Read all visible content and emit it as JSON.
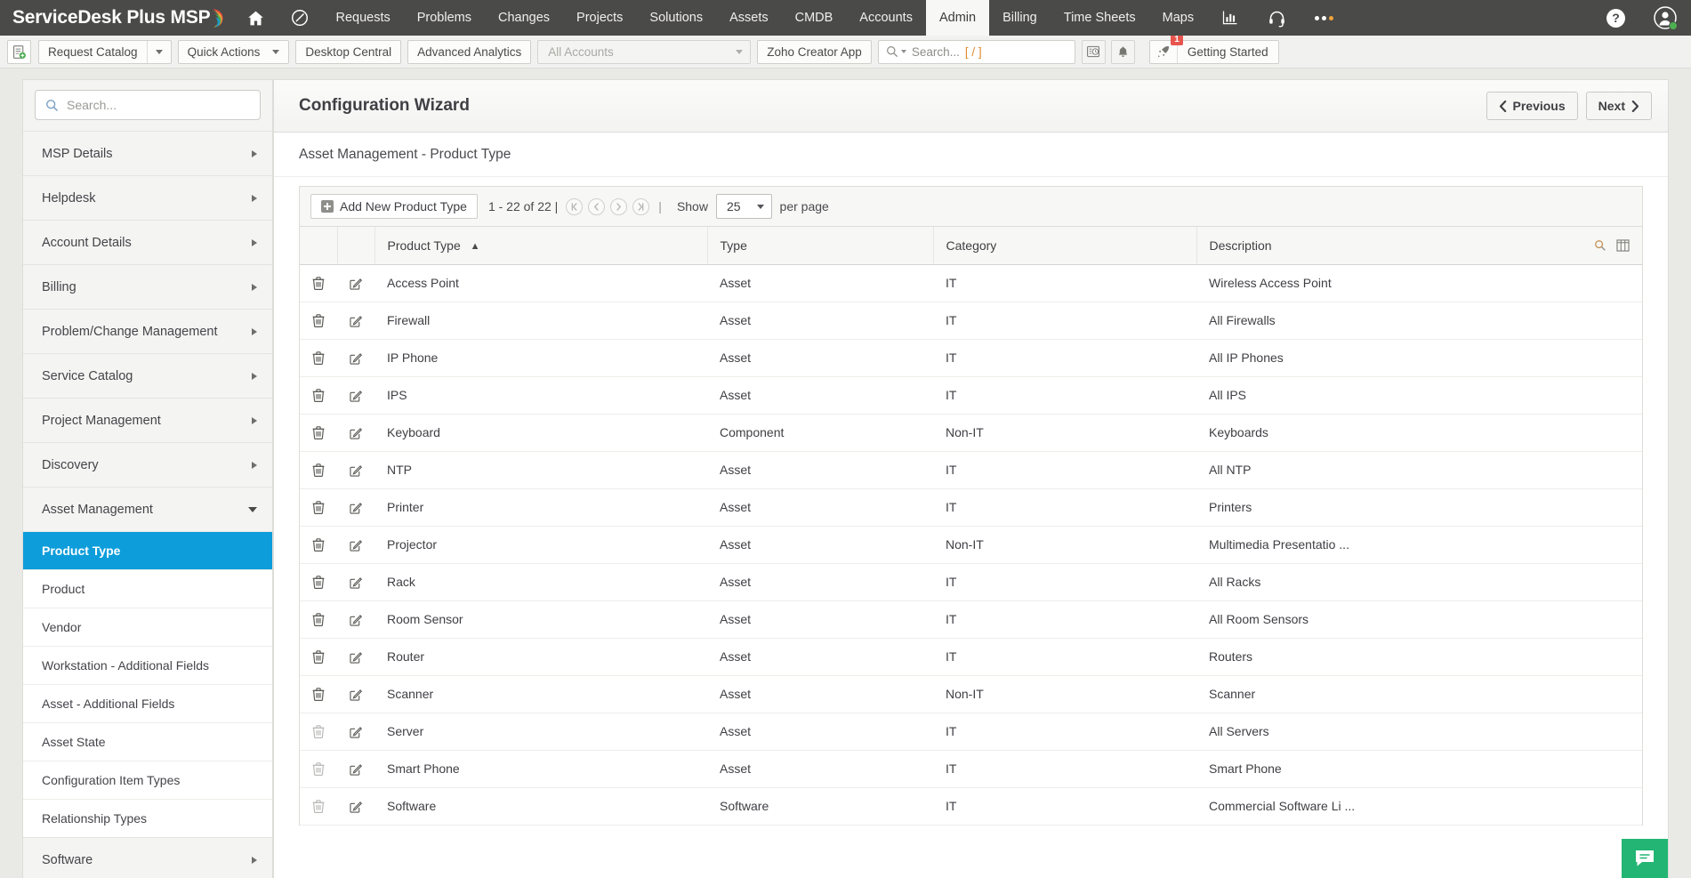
{
  "topnav": {
    "brand": "ServiceDesk Plus MSP",
    "items": [
      {
        "label": "Requests",
        "active": false
      },
      {
        "label": "Problems",
        "active": false
      },
      {
        "label": "Changes",
        "active": false
      },
      {
        "label": "Projects",
        "active": false
      },
      {
        "label": "Solutions",
        "active": false
      },
      {
        "label": "Assets",
        "active": false
      },
      {
        "label": "CMDB",
        "active": false
      },
      {
        "label": "Accounts",
        "active": false
      },
      {
        "label": "Admin",
        "active": true
      },
      {
        "label": "Billing",
        "active": false
      },
      {
        "label": "Time Sheets",
        "active": false
      },
      {
        "label": "Maps",
        "active": false
      }
    ],
    "icons": {
      "home": "home-icon",
      "dashboard": "speedometer-icon",
      "reports": "bar-chart-icon",
      "support": "headset-icon",
      "more": "more-dots-icon",
      "help": "help-icon",
      "profile": "user-avatar-icon"
    },
    "help_glyph": "?"
  },
  "toolbar": {
    "new_request_icon": "new-request-icon",
    "request_catalog": "Request Catalog",
    "quick_actions": "Quick Actions",
    "desktop_central": "Desktop Central",
    "advanced_analytics": "Advanced Analytics",
    "accounts_placeholder": "All Accounts",
    "zoho_creator": "Zoho Creator App",
    "search_placeholder": "Search...",
    "search_shortcut": "[ / ]",
    "recent_items_icon": "recent-items-icon",
    "notifications_icon": "bell-icon",
    "rocket_icon": "rocket-icon",
    "getting_started": "Getting Started",
    "getting_started_badge": "1"
  },
  "sidebar": {
    "search_placeholder": "Search...",
    "items": [
      {
        "label": "MSP Details",
        "expanded": false
      },
      {
        "label": "Helpdesk",
        "expanded": false
      },
      {
        "label": "Account Details",
        "expanded": false
      },
      {
        "label": "Billing",
        "expanded": false
      },
      {
        "label": "Problem/Change Management",
        "expanded": false
      },
      {
        "label": "Service Catalog",
        "expanded": false
      },
      {
        "label": "Project Management",
        "expanded": false
      },
      {
        "label": "Discovery",
        "expanded": false
      },
      {
        "label": "Asset Management",
        "expanded": true
      }
    ],
    "asset_management_children": [
      {
        "label": "Product Type",
        "active": true
      },
      {
        "label": "Product",
        "active": false
      },
      {
        "label": "Vendor",
        "active": false
      },
      {
        "label": "Workstation - Additional Fields",
        "active": false
      },
      {
        "label": "Asset - Additional Fields",
        "active": false
      },
      {
        "label": "Asset State",
        "active": false
      },
      {
        "label": "Configuration Item Types",
        "active": false
      },
      {
        "label": "Relationship Types",
        "active": false
      }
    ],
    "trailing_item": {
      "label": "Software",
      "expanded": false
    }
  },
  "main": {
    "title": "Configuration Wizard",
    "previous_label": "Previous",
    "next_label": "Next",
    "breadcrumb": "Asset Management - Product Type",
    "add_button": "Add New Product Type",
    "page_range": "1 - 22 of 22 |",
    "pipe": "|",
    "show_label": "Show",
    "per_page_value": "25",
    "per_page_label": "per page",
    "pagination_icons": [
      "first-page-icon",
      "previous-page-icon",
      "next-page-icon",
      "last-page-icon"
    ],
    "header_search_icon": "search-icon",
    "header_columns_icon": "column-chooser-icon",
    "columns": [
      "Product Type",
      "Type",
      "Category",
      "Description"
    ],
    "sort_column": "Product Type",
    "sort_direction": "ascending",
    "rows": [
      {
        "name": "Access Point",
        "type": "Asset",
        "category": "IT",
        "description": "Wireless Access Point",
        "deletable": true
      },
      {
        "name": "Firewall",
        "type": "Asset",
        "category": "IT",
        "description": "All Firewalls",
        "deletable": true
      },
      {
        "name": "IP Phone",
        "type": "Asset",
        "category": "IT",
        "description": "All IP Phones",
        "deletable": true
      },
      {
        "name": "IPS",
        "type": "Asset",
        "category": "IT",
        "description": "All IPS",
        "deletable": true
      },
      {
        "name": "Keyboard",
        "type": "Component",
        "category": "Non-IT",
        "description": "Keyboards",
        "deletable": true
      },
      {
        "name": "NTP",
        "type": "Asset",
        "category": "IT",
        "description": "All NTP",
        "deletable": true
      },
      {
        "name": "Printer",
        "type": "Asset",
        "category": "IT",
        "description": "Printers",
        "deletable": true
      },
      {
        "name": "Projector",
        "type": "Asset",
        "category": "Non-IT",
        "description": "Multimedia Presentatio ...",
        "deletable": true
      },
      {
        "name": "Rack",
        "type": "Asset",
        "category": "IT",
        "description": "All Racks",
        "deletable": true
      },
      {
        "name": "Room Sensor",
        "type": "Asset",
        "category": "IT",
        "description": "All Room Sensors",
        "deletable": true
      },
      {
        "name": "Router",
        "type": "Asset",
        "category": "IT",
        "description": "Routers",
        "deletable": true
      },
      {
        "name": "Scanner",
        "type": "Asset",
        "category": "Non-IT",
        "description": "Scanner",
        "deletable": true
      },
      {
        "name": "Server",
        "type": "Asset",
        "category": "IT",
        "description": "All Servers",
        "deletable": false
      },
      {
        "name": "Smart Phone",
        "type": "Asset",
        "category": "IT",
        "description": "Smart Phone",
        "deletable": false
      },
      {
        "name": "Software",
        "type": "Software",
        "category": "IT",
        "description": "Commercial Software Li ...",
        "deletable": false
      }
    ]
  },
  "chat": {
    "icon": "chat-icon"
  },
  "colors": {
    "nav_bg": "#4a4a48",
    "accent_blue": "#0d9ddb",
    "badge_red": "#e8554e",
    "chat_green": "#22b573",
    "status_green": "#4caf50",
    "orange": "#e08a2e"
  }
}
